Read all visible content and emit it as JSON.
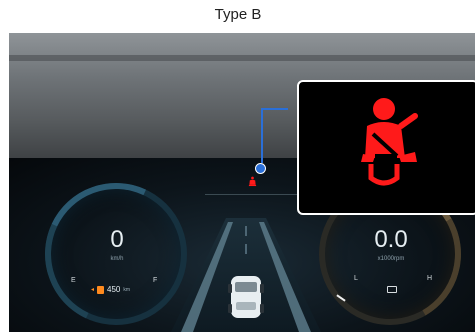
{
  "title": "Type B",
  "speedometer": {
    "value": "0",
    "unit": "km/h",
    "empty": "E",
    "full": "F",
    "range": "450",
    "range_unit": "km"
  },
  "tachometer": {
    "value": "0.0",
    "unit": "x1000rpm",
    "low": "L",
    "high": "H"
  },
  "warning": {
    "icon": "seatbelt-warning-icon",
    "color": "#ff1a1a"
  },
  "colors": {
    "callout": "#2a6fd8",
    "fuel_warning": "#ff8a1e"
  }
}
